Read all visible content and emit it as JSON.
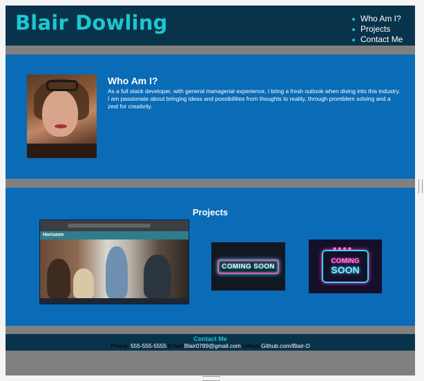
{
  "header": {
    "title": "Blair Dowling",
    "nav": [
      {
        "label": "Who Am I?"
      },
      {
        "label": "Projects"
      },
      {
        "label": "Contact Me"
      }
    ]
  },
  "about": {
    "heading": "Who Am I?",
    "text": "As a full stack developer, with general managerial experience, I bring a fresh outlook when diving into this industry. I am passionate about bringing ideas and possibilities from thoughts to reality, through promblem solving and a zest for creativity."
  },
  "projects": {
    "heading": "Projects",
    "main_project_logo": "Horiseon",
    "tiles": [
      {
        "label": "COMING SOON"
      },
      {
        "label_top": "COMING",
        "label_bottom": "SOON"
      }
    ]
  },
  "footer": {
    "heading": "Contact Me",
    "phone_label": "Phone:",
    "phone_value": "555-555-5555",
    "email_label": "Email:",
    "email_value": "Blair0789@gmail.com",
    "github_label": "Github:",
    "github_value": "Github.com/Blair-D"
  },
  "colors": {
    "header_bg": "#09334a",
    "accent": "#1cc7d0",
    "section_bg": "#0a6bb6",
    "divider": "#808080"
  }
}
